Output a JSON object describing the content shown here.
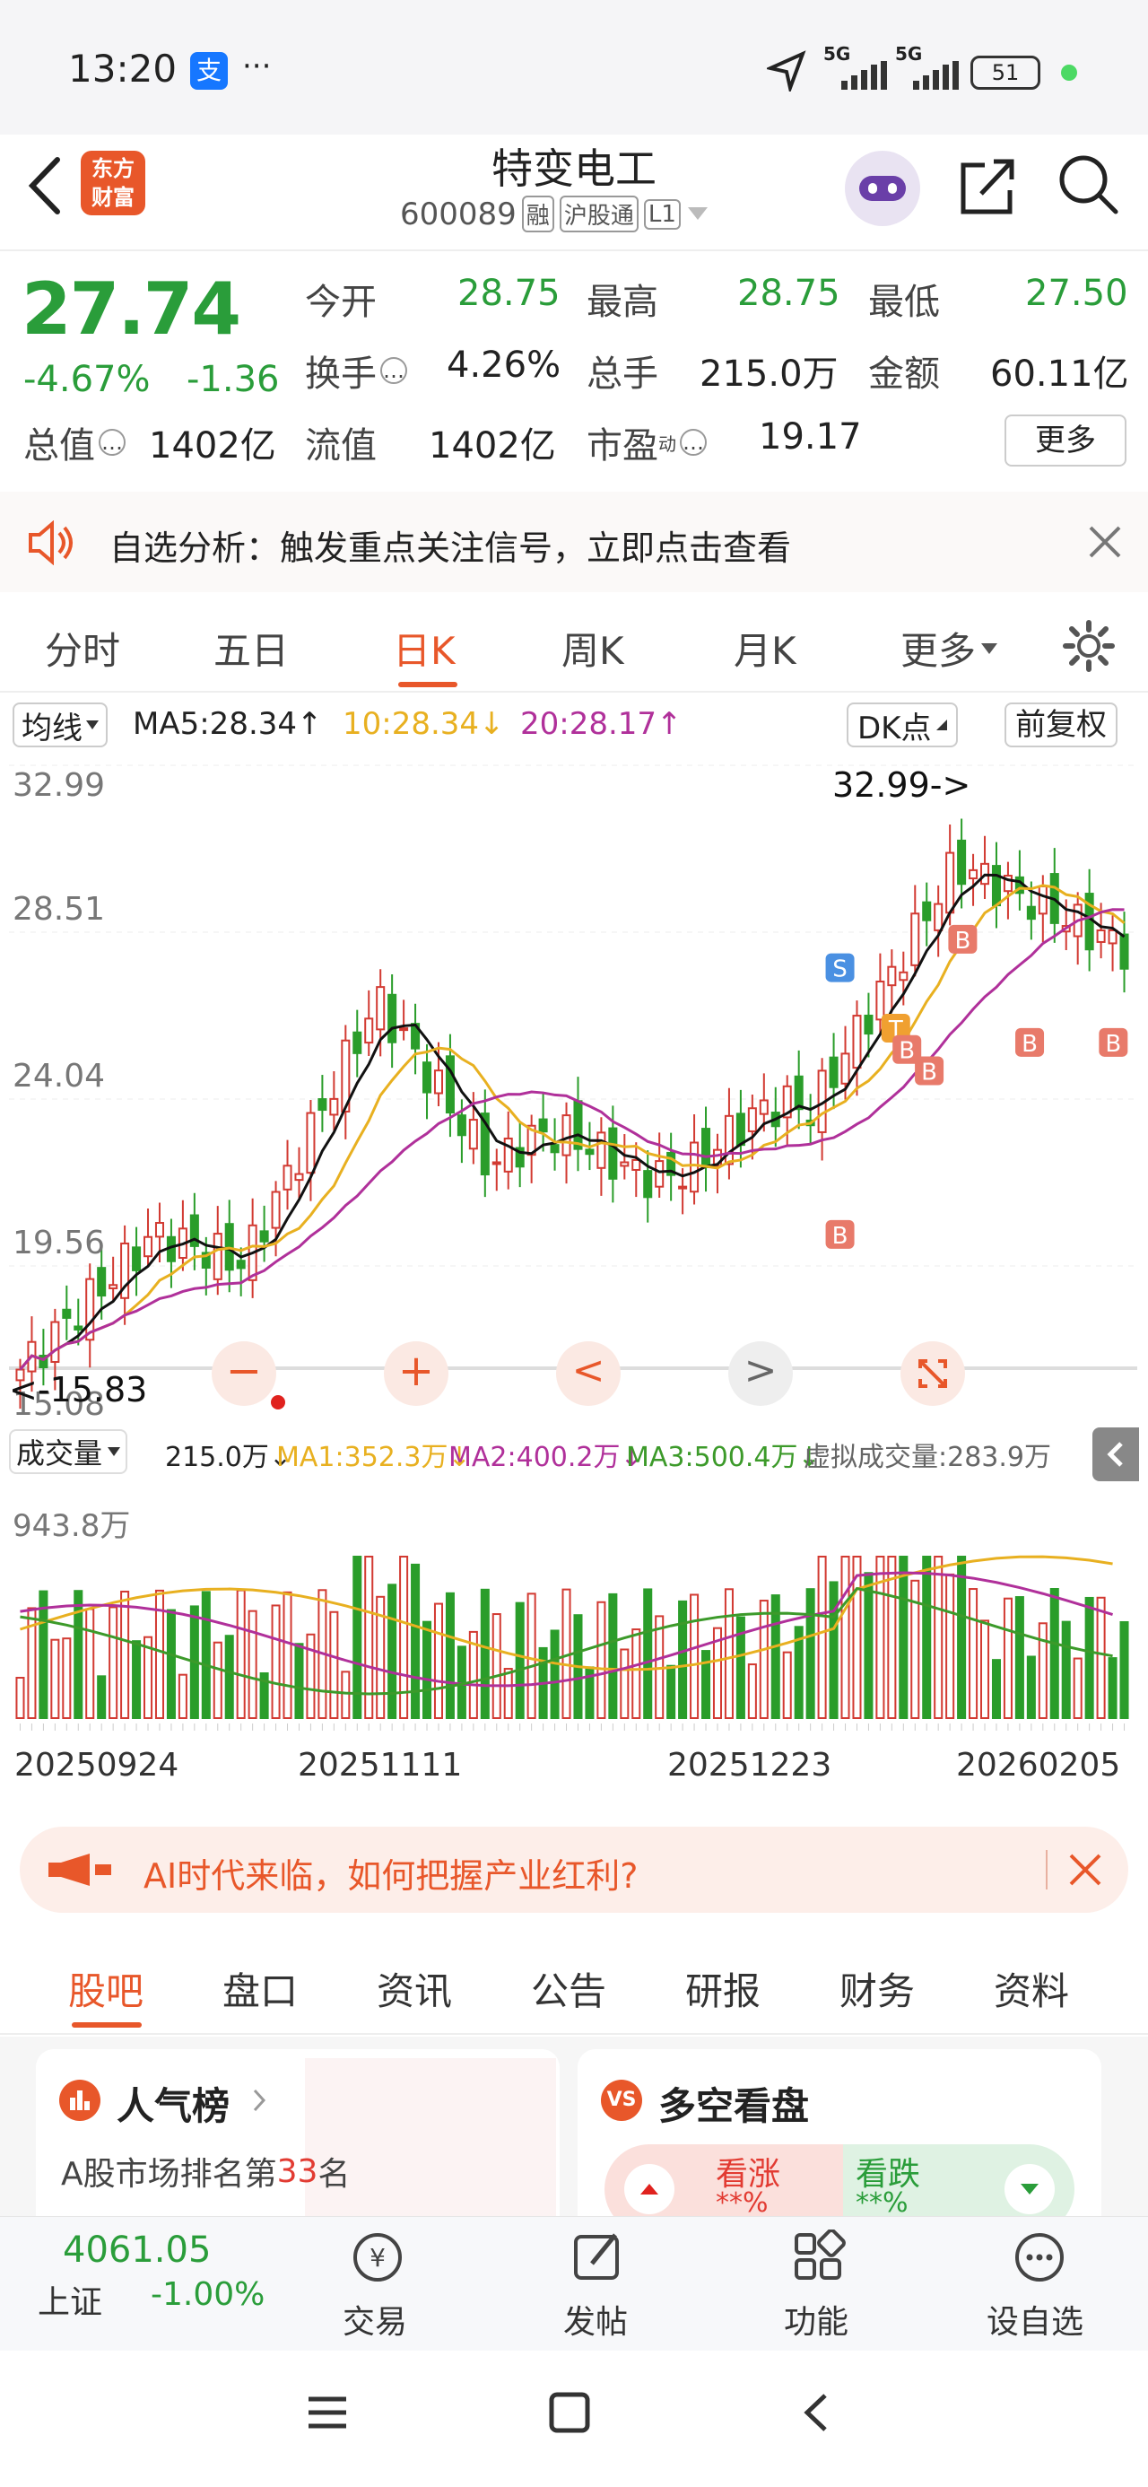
{
  "status_bar": {
    "time": "13:20",
    "app_badge": "支",
    "more": "···",
    "signal_1": "5G",
    "signal_2": "5G",
    "battery": "51"
  },
  "header": {
    "back_icon": "chevron-left-icon",
    "logo_line1": "东方",
    "logo_line2": "财富",
    "title": "特变电工",
    "code": "600089",
    "tag_margin": "融",
    "tag_connect": "沪股通",
    "tag_level": "L1"
  },
  "quote": {
    "price": "27.74",
    "change_pct": "-4.67%",
    "change_abs": "-1.36",
    "open_label": "今开",
    "open": "28.75",
    "high_label": "最高",
    "high": "28.75",
    "low_label": "最低",
    "low": "27.50",
    "turnover_label": "换手",
    "turnover": "4.26%",
    "volume_label": "总手",
    "volume": "215.0万",
    "amount_label": "金额",
    "amount": "60.11亿",
    "mcap_label": "总值",
    "mcap": "1402亿",
    "float_label": "流值",
    "float": "1402亿",
    "pe_label": "市盈",
    "pe_sup": "动",
    "pe": "19.17",
    "more_button": "更多"
  },
  "banner1": {
    "text": "自选分析：触发重点关注信号，立即点击查看"
  },
  "ktabs": {
    "items": [
      "分时",
      "五日",
      "日K",
      "周K",
      "月K",
      "更多"
    ],
    "active": "日K"
  },
  "ma_bar": {
    "ma_select": "均线",
    "ma5": "MA5:28.34↑",
    "ma10": "10:28.34↓",
    "ma20": "20:28.17↑",
    "dk": "DK点",
    "fq": "前复权"
  },
  "chart_data": {
    "type": "candlestick",
    "price_axis_labels": [
      "32.99",
      "28.51",
      "24.04",
      "19.56",
      "15.08"
    ],
    "ylim": [
      15.08,
      32.99
    ],
    "max_annotation": "32.99->",
    "min_annotation": "<-15.83",
    "signals": [
      "S",
      "B",
      "T",
      "B",
      "B",
      "B",
      "B",
      "B"
    ],
    "volume": {
      "select": "成交量",
      "current": "215.0万↓",
      "ma1": "MA1:352.3万↓",
      "ma2": "MA2:400.2万↓",
      "ma3": "MA3:500.4万↓",
      "virtual": "虚拟成交量:283.9万",
      "axis_max": "943.8万"
    },
    "x_labels": [
      "20250924",
      "20251111",
      "20251223",
      "20260205"
    ],
    "colors": {
      "up": "#d23a32",
      "down": "#2a9d2a",
      "ma5": "#111111",
      "ma10": "#e8b020",
      "ma20": "#b0309a"
    }
  },
  "chart_tools": {
    "minus": "−",
    "plus": "+",
    "prev": "<",
    "next": ">"
  },
  "adbar": {
    "text": "AI时代来临，如何把握产业红利?"
  },
  "btabs": {
    "items": [
      "股吧",
      "盘口",
      "资讯",
      "公告",
      "研报",
      "财务",
      "资料"
    ],
    "active": "股吧"
  },
  "cards": {
    "rank_title": "人气榜",
    "rank_text_pre": "A股市场排名第",
    "rank_num": "33",
    "rank_text_post": "名",
    "ls_title": "多空看盘",
    "bull": "看涨",
    "bear": "看跌",
    "masked": "**%"
  },
  "bottom": {
    "index_value": "4061.05",
    "index_name": "上证",
    "index_change": "-1.00%",
    "trade": "交易",
    "post": "发帖",
    "func": "功能",
    "watch": "设自选"
  }
}
